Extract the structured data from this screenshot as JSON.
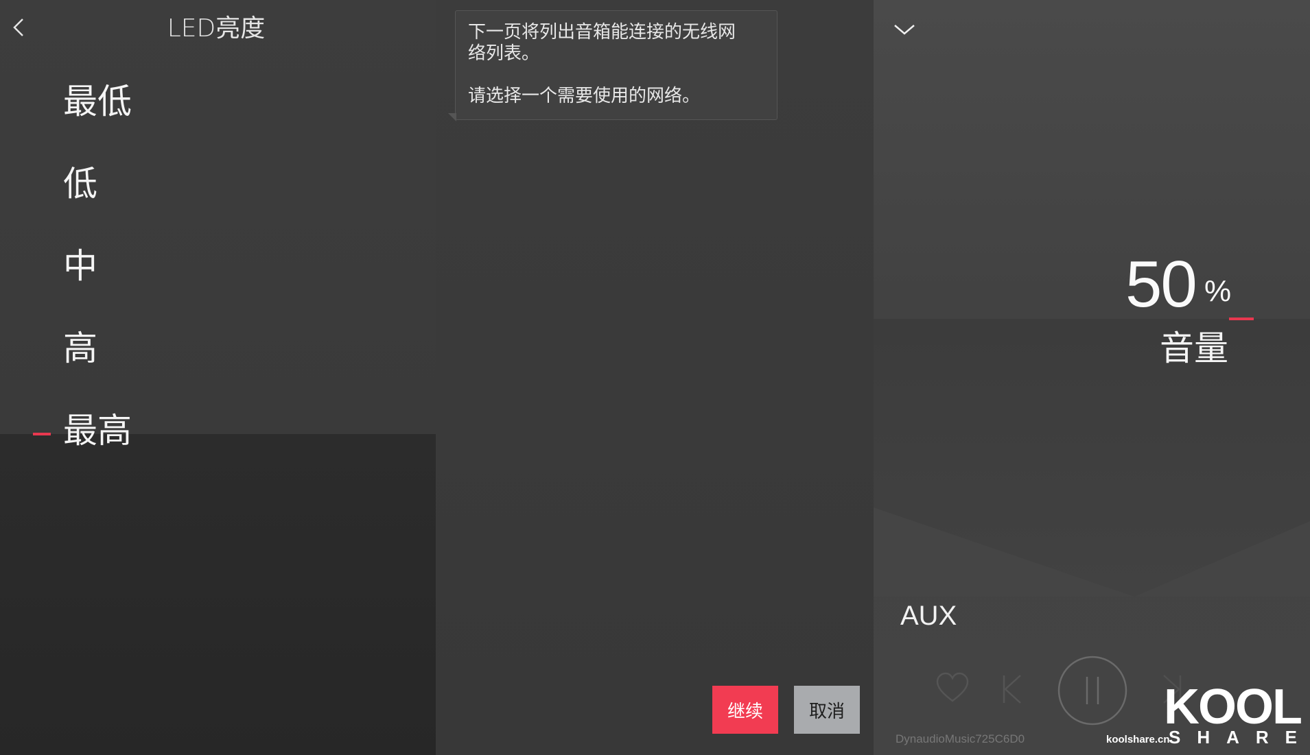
{
  "led_panel": {
    "title": "LED亮度",
    "options": [
      "最低",
      "低",
      "中",
      "高",
      "最高"
    ],
    "selected": "最高"
  },
  "wifi_dialog": {
    "message_line1": "下一页将列出音箱能连接的无线网络列表。",
    "message_line2": "请选择一个需要使用的网络。",
    "continue_label": "继续",
    "cancel_label": "取消"
  },
  "volume_panel": {
    "value": "50",
    "unit": "%",
    "label": "音量",
    "source": "AUX",
    "device_name": "DynaudioMusic725C6D0"
  },
  "watermark": {
    "site": "koolshare.cn",
    "brand": "KOOL",
    "brand_sub": "SHARE"
  },
  "colors": {
    "accent": "#f23c52",
    "cancel": "#a9abae",
    "bg": "#3a3a3a"
  }
}
